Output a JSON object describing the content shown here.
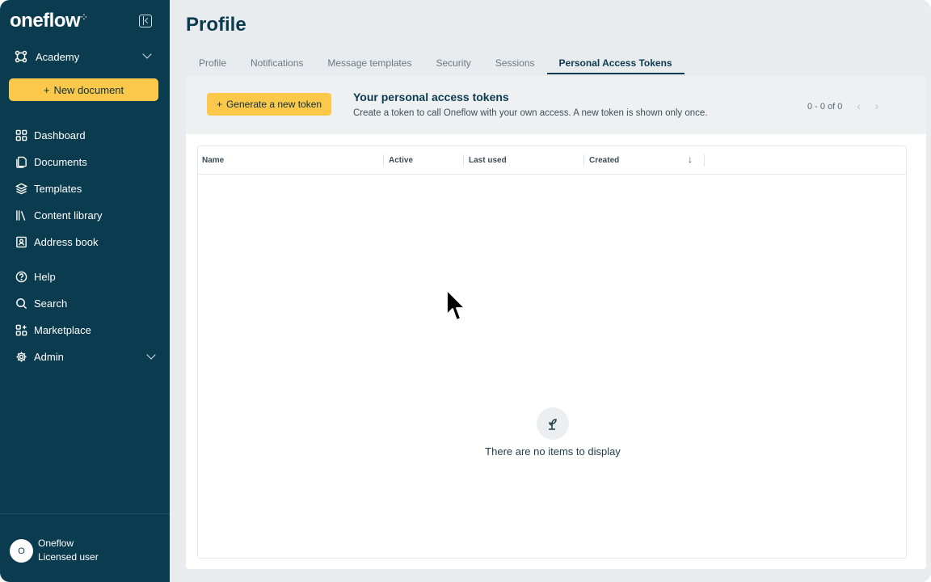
{
  "sidebar": {
    "brand": "oneflow",
    "workspace": "Academy",
    "new_document": "New document",
    "nav": [
      {
        "label": "Dashboard"
      },
      {
        "label": "Documents"
      },
      {
        "label": "Templates"
      },
      {
        "label": "Content library"
      },
      {
        "label": "Address book"
      },
      {
        "label": "Help"
      },
      {
        "label": "Search"
      },
      {
        "label": "Marketplace"
      },
      {
        "label": "Admin"
      }
    ],
    "user": {
      "initial": "O",
      "name": "Oneflow",
      "role": "Licensed user"
    }
  },
  "main": {
    "title": "Profile",
    "tabs": [
      {
        "label": "Profile"
      },
      {
        "label": "Notifications"
      },
      {
        "label": "Message templates"
      },
      {
        "label": "Security"
      },
      {
        "label": "Sessions"
      },
      {
        "label": "Personal Access Tokens"
      }
    ],
    "card": {
      "generate_button": "Generate a new token",
      "title": "Your personal access tokens",
      "description": "Create a token to call Oneflow with your own access. A new token is shown only once.",
      "pager": "0 - 0 of 0",
      "columns": [
        "Name",
        "Active",
        "Last used",
        "Created"
      ],
      "empty_message": "There are no items to display"
    }
  },
  "colors": {
    "sidebar": "#0b3b4f",
    "accent": "#fbc84a",
    "background": "#e9ecef"
  },
  "icons": [
    "collapse-sidebar-icon",
    "academy-icon",
    "chevron-down-icon",
    "plus-icon",
    "dashboard-icon",
    "documents-icon",
    "templates-icon",
    "content-library-icon",
    "address-book-icon",
    "help-icon",
    "search-icon",
    "marketplace-icon",
    "admin-gear-icon",
    "chevron-left-icon",
    "chevron-right-icon",
    "sort-down-icon",
    "sprout-icon",
    "mouse-cursor-icon"
  ]
}
